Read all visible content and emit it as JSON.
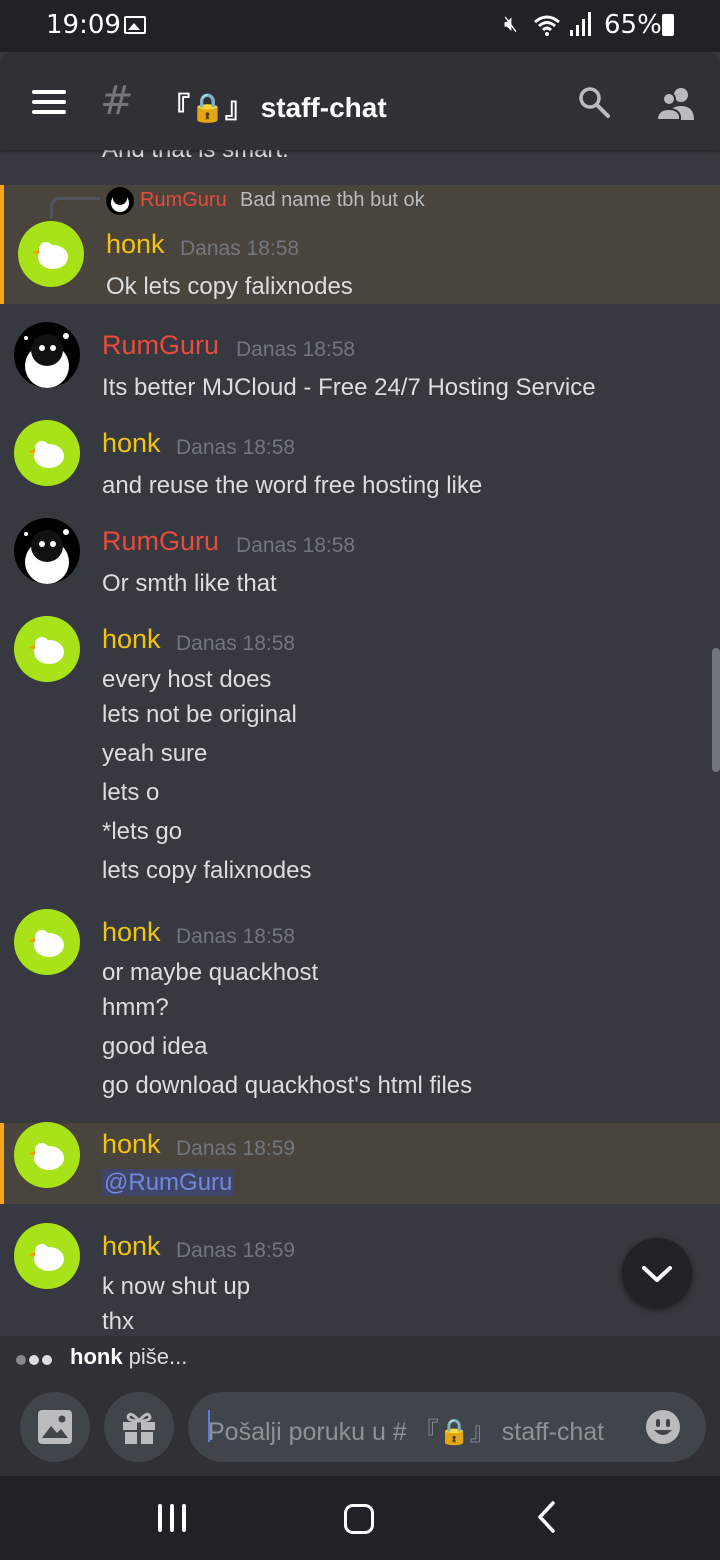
{
  "status_bar": {
    "time": "19:09",
    "battery": "65%"
  },
  "header": {
    "channel": "『🔒』 staff-chat"
  },
  "cut_text": "And that is smart.",
  "reply": {
    "author": "RumGuru",
    "text": "Bad name tbh but ok"
  },
  "messages": [
    {
      "author": "honk",
      "time": "Danas 18:58",
      "lines": [
        "Ok lets copy falixnodes"
      ]
    },
    {
      "author": "RumGuru",
      "time": "Danas 18:58",
      "lines": [
        "Its better MJCloud - Free 24/7 Hosting Service"
      ]
    },
    {
      "author": "honk",
      "time": "Danas 18:58",
      "lines": [
        "and reuse the word free hosting like"
      ]
    },
    {
      "author": "RumGuru",
      "time": "Danas 18:58",
      "lines": [
        "Or smth like that"
      ]
    },
    {
      "author": "honk",
      "time": "Danas 18:58",
      "lines": [
        "every host does",
        "lets not be original",
        "yeah sure",
        "lets o",
        "*lets go",
        "lets copy falixnodes"
      ]
    },
    {
      "author": "honk",
      "time": "Danas 18:58",
      "lines": [
        "or maybe quackhost",
        "hmm?",
        "good idea",
        "go download quackhost's html files"
      ]
    },
    {
      "author": "honk",
      "time": "Danas 18:59",
      "lines": [
        "@RumGuru"
      ]
    },
    {
      "author": "honk",
      "time": "Danas 18:59",
      "lines": [
        "k now shut up",
        "thx"
      ]
    }
  ],
  "typing": {
    "user": "honk",
    "text": " piše..."
  },
  "composer": {
    "placeholder": "Pošalji poruku u # 『🔒』 staff-chat"
  },
  "colors": {
    "background": "#36393f",
    "header": "#2f3136",
    "honk": "#f1c40f",
    "rumguru": "#e74c3c",
    "mention_bg": "#49443c",
    "mention_bar": "#faa61a"
  }
}
